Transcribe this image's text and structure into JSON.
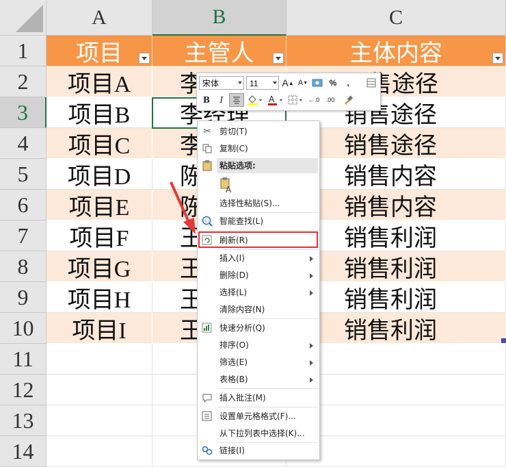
{
  "columns": [
    "A",
    "B",
    "C"
  ],
  "rows": [
    "1",
    "2",
    "3",
    "4",
    "5",
    "6",
    "7",
    "8",
    "9",
    "10",
    "11",
    "12",
    "13",
    "14"
  ],
  "headers": {
    "a": "项目",
    "b": "主管人",
    "c": "主体内容"
  },
  "table": [
    {
      "a": "项目A",
      "b": "李",
      "c": "售途径"
    },
    {
      "a": "项目B",
      "b": "李经理",
      "c": "销售途径"
    },
    {
      "a": "项目C",
      "b": "李",
      "c": "销售途径"
    },
    {
      "a": "项目D",
      "b": "陈",
      "c": "销售内容"
    },
    {
      "a": "项目E",
      "b": "陈",
      "c": "销售内容"
    },
    {
      "a": "项目F",
      "b": "王",
      "c": "销售利润"
    },
    {
      "a": "项目G",
      "b": "王",
      "c": "销售利润"
    },
    {
      "a": "项目H",
      "b": "王",
      "c": "销售利润"
    },
    {
      "a": "项目I",
      "b": "王",
      "c": "销售利润"
    }
  ],
  "mini_toolbar": {
    "font_name": "宋体",
    "font_size": "11",
    "grow": "A",
    "shrink": "A",
    "percent": "%",
    "comma": ",",
    "bold": "B",
    "italic": "I",
    "font_color_letter": "A",
    "inc_decimal": "←.0",
    "dec_decimal": ".00"
  },
  "menu": {
    "cut": "剪切(T)",
    "copy": "复制(C)",
    "paste_options": "粘贴选项:",
    "paste_special": "选择性粘贴(S)...",
    "smart_lookup": "智能查找(L)",
    "refresh": "刷新(R)",
    "insert": "插入(I)",
    "delete": "删除(D)",
    "select": "选择(L)",
    "clear": "清除内容(N)",
    "quick_analysis": "快速分析(Q)",
    "sort": "排序(O)",
    "filter": "筛选(E)",
    "table": "表格(B)",
    "insert_comment": "插入批注(M)",
    "format_cells": "设置单元格格式(F)...",
    "pick_list": "从下拉列表中选择(K)...",
    "link": "链接(I)"
  },
  "colors": {
    "header_fill": "#f79646",
    "band_fill": "#fde9d9",
    "selection": "#217346",
    "highlight": "#e03030"
  }
}
